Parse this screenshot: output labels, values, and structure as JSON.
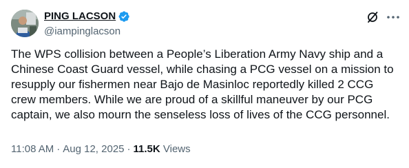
{
  "author": {
    "display_name": "PING LACSON",
    "handle": "@iampinglacson",
    "verified": true
  },
  "icons": {
    "verified": "verified-badge-icon",
    "grok": "grok-icon",
    "more": "more-options-icon"
  },
  "tweet": {
    "text": "The WPS collision between a People’s Liberation Army Navy ship and a\nChinese Coast Guard vessel, while chasing a PCG vessel on a mission to\nresupply our fishermen near Bajo de Masinloc reportedly killed 2 CCG\ncrew members. While we are proud of a skillful maneuver by our PCG\ncaptain, we also mourn the senseless loss of lives of the CCG personnel."
  },
  "meta": {
    "time": "11:08 AM",
    "separator": "·",
    "date": "Aug 12, 2025",
    "views_count": "11.5K",
    "views_label": "Views"
  },
  "colors": {
    "text_primary": "#0f1419",
    "text_secondary": "#536471",
    "verified_blue": "#1d9bf0",
    "background": "#ffffff"
  }
}
